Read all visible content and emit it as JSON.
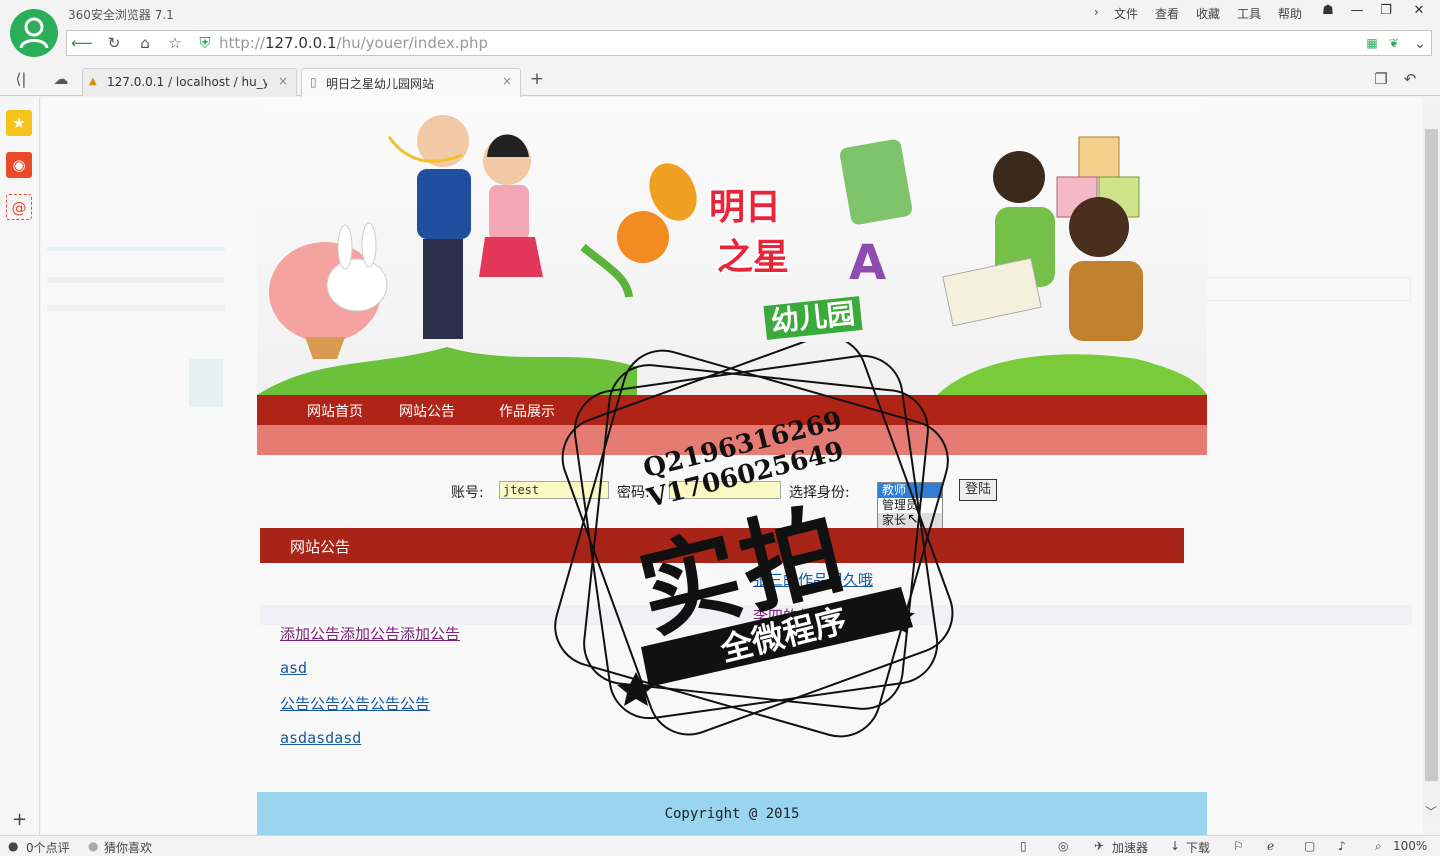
{
  "browser": {
    "app_title": "360安全浏览器 7.1",
    "menu": [
      "文件",
      "查看",
      "收藏",
      "工具",
      "帮助"
    ],
    "address": {
      "prefix": "http://",
      "host": "127.0.0.1",
      "path": "/hu/youer/index.php"
    },
    "tabs": [
      {
        "label": "127.0.0.1 / localhost / hu_yo",
        "close": "×"
      },
      {
        "label": "明日之星幼儿园网站",
        "close": "×"
      }
    ],
    "new_tab": "+"
  },
  "site": {
    "banner_logo": [
      "明日",
      "之星",
      "幼儿园"
    ],
    "nav": [
      "网站首页",
      "网站公告",
      "作品展示"
    ],
    "login": {
      "account_label": "账号:",
      "account_value": "jtest",
      "password_label": "密码:",
      "role_label": "选择身份:",
      "role_options": [
        "教师",
        "管理员",
        "家长"
      ],
      "login_button": "登陆"
    },
    "notice_title": "网站公告",
    "notices": [
      "添加公告添加公告添加公告",
      "asd",
      "公告公告公告公告公告",
      "asdasdasd"
    ],
    "works": [
      "张三的作品很久哦",
      "李四的作品不错哦"
    ],
    "copyright": "Copyright @ 2015"
  },
  "watermark": {
    "line1": "Q2196316269",
    "line2": "V1706025649",
    "big": "实拍",
    "banner": "全微程序"
  },
  "statusbar": {
    "reviews": "0个点评",
    "guess": "猜你喜欢",
    "accelerator": "加速器",
    "download": "下载",
    "zoom": "100%"
  },
  "colors": {
    "nav_red": "#b02418",
    "nav_pink": "#e57b72",
    "footer_blue": "#9ad5ef",
    "logo_green": "#2aae5a"
  }
}
